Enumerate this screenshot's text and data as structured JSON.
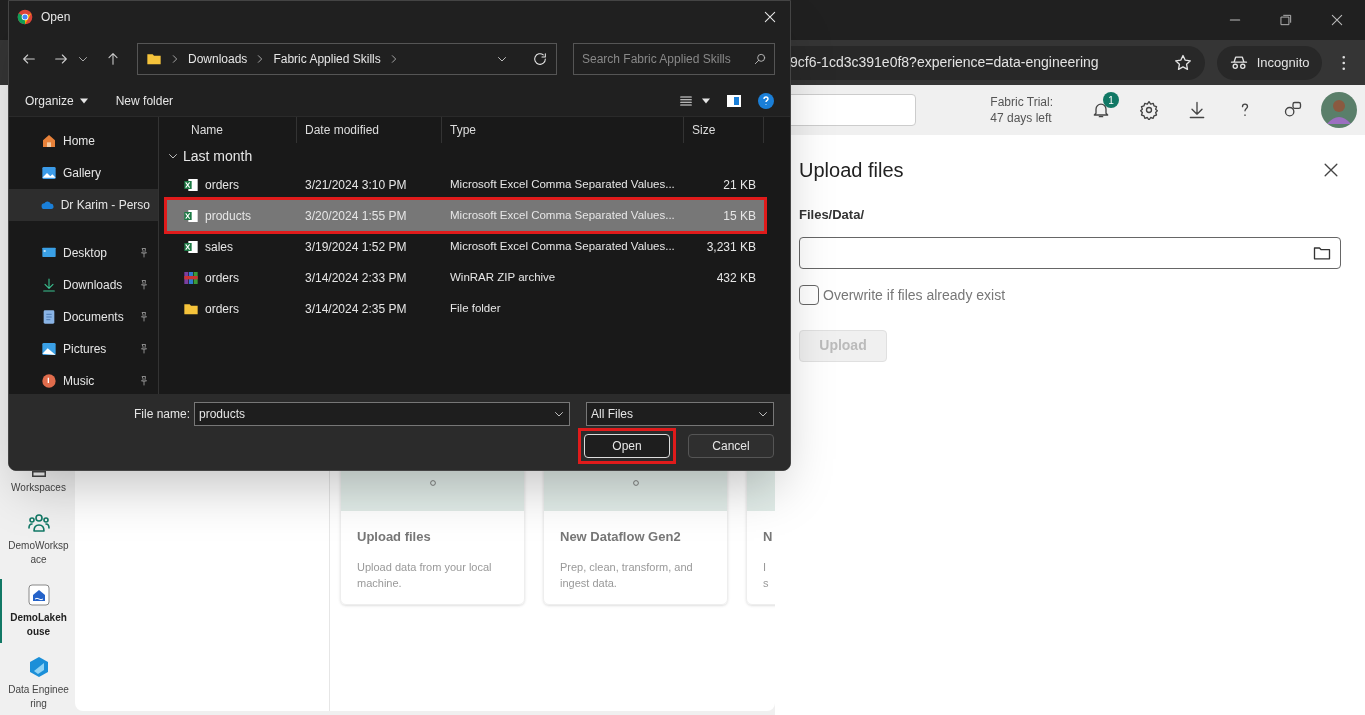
{
  "browser": {
    "url": "9cf6-1cd3c391e0f8?experience=data-engineering",
    "incognito_label": "Incognito"
  },
  "header": {
    "trial_line1": "Fabric Trial:",
    "trial_line2": "47 days left",
    "notification_count": "1"
  },
  "nav": [
    {
      "label": "Workspaces",
      "selected": false
    },
    {
      "label": "DemoWorkspace",
      "selected": false
    },
    {
      "label": "DemoLakehouse",
      "selected": true
    },
    {
      "label": "Data Engineering",
      "selected": false
    }
  ],
  "cards": [
    {
      "title": "Upload files",
      "description": [
        "Upload data from your local",
        "machine."
      ]
    },
    {
      "title": "New Dataflow Gen2",
      "description": [
        "Prep, clean, transform, and",
        "ingest data."
      ]
    },
    {
      "title": "N",
      "description": [
        "I",
        "s"
      ]
    }
  ],
  "upload_panel": {
    "title": "Upload files",
    "path_label": "Files/Data/",
    "overwrite_label": "Overwrite if files already exist",
    "overwrite_checked": false,
    "upload_button": "Upload",
    "upload_disabled": true
  },
  "dialog": {
    "title": "Open",
    "breadcrumb": [
      "Downloads",
      "Fabric Applied Skills"
    ],
    "search_placeholder": "Search Fabric Applied Skills",
    "toolbar": {
      "organize": "Organize",
      "new_folder": "New folder"
    },
    "sidebar": [
      {
        "label": "Home",
        "pinned": false,
        "selected": false
      },
      {
        "label": "Gallery",
        "pinned": false,
        "selected": false
      },
      {
        "label": "Dr Karim - Perso",
        "pinned": false,
        "selected": true
      },
      {
        "label": "Desktop",
        "pinned": true,
        "selected": false
      },
      {
        "label": "Downloads",
        "pinned": true,
        "selected": false
      },
      {
        "label": "Documents",
        "pinned": true,
        "selected": false
      },
      {
        "label": "Pictures",
        "pinned": true,
        "selected": false
      },
      {
        "label": "Music",
        "pinned": true,
        "selected": false
      }
    ],
    "columns": [
      "Name",
      "Date modified",
      "Type",
      "Size"
    ],
    "group": {
      "label": "Last month",
      "expanded": true
    },
    "files": [
      {
        "kind": "csv",
        "name": "orders",
        "date": "3/21/2024 3:10 PM",
        "type": "Microsoft Excel Comma Separated Values...",
        "size": "21 KB",
        "selected": false,
        "highlighted": false
      },
      {
        "kind": "csv",
        "name": "products",
        "date": "3/20/2024 1:55 PM",
        "type": "Microsoft Excel Comma Separated Values...",
        "size": "15 KB",
        "selected": true,
        "highlighted": true
      },
      {
        "kind": "csv",
        "name": "sales",
        "date": "3/19/2024 1:52 PM",
        "type": "Microsoft Excel Comma Separated Values...",
        "size": "3,231 KB",
        "selected": false,
        "highlighted": false
      },
      {
        "kind": "zip",
        "name": "orders",
        "date": "3/14/2024 2:33 PM",
        "type": "WinRAR ZIP archive",
        "size": "432 KB",
        "selected": false,
        "highlighted": false
      },
      {
        "kind": "folder",
        "name": "orders",
        "date": "3/14/2024 2:35 PM",
        "type": "File folder",
        "selected": false,
        "highlighted": false
      }
    ],
    "file_name_label": "File name:",
    "file_name": "products",
    "filter": "All Files",
    "open_button": "Open",
    "open_highlighted": true,
    "cancel_button": "Cancel"
  }
}
